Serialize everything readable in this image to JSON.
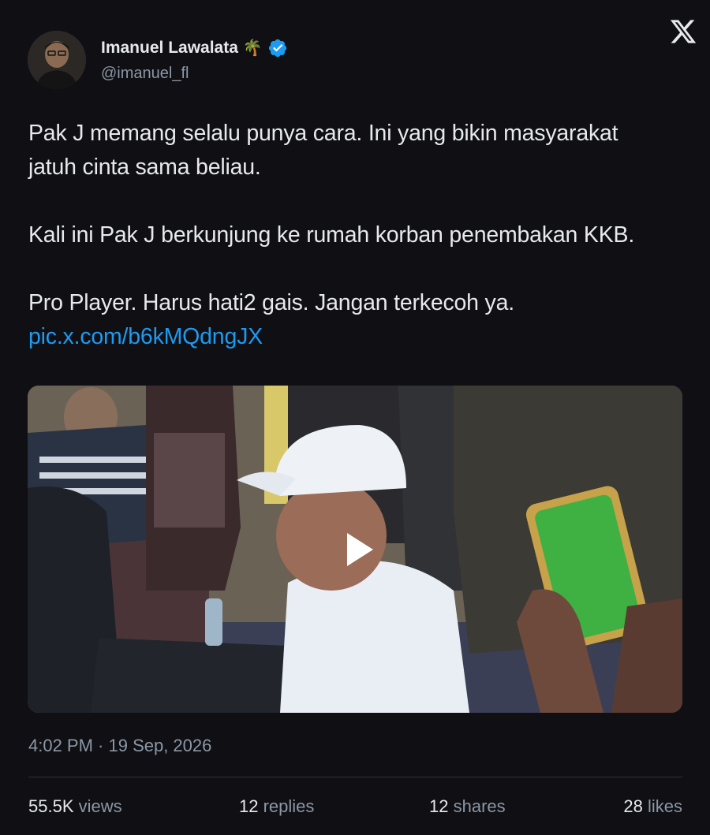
{
  "author": {
    "name": "Imanuel Lawalata",
    "emoji": "🌴",
    "handle": "@imanuel_fl"
  },
  "tweet": {
    "line1": "Pak J memang selalu punya cara. Ini yang bikin masyarakat",
    "line2": "jatuh cinta sama beliau.",
    "line3": "Kali ini Pak J berkunjung ke rumah korban penembakan KKB.",
    "line4": "Pro Player. Harus hati2 gais. Jangan terkecoh ya.",
    "link": "pic.x.com/b6kMQdngJX"
  },
  "meta": {
    "timestamp": "4:02 PM · 19 Sep, 2026"
  },
  "stats": {
    "views_value": "55.5K",
    "views_label": "views",
    "replies_value": "12",
    "replies_label": "replies",
    "shares_value": "12",
    "shares_label": "shares",
    "likes_value": "28",
    "likes_label": "likes"
  },
  "icons": {
    "close": "x-logo-icon",
    "verified": "verified-badge-icon",
    "play": "play-icon"
  },
  "colors": {
    "background": "#0f0f14",
    "text": "#e7e9ea",
    "muted": "#8b98a5",
    "link": "#1d9bf0"
  }
}
